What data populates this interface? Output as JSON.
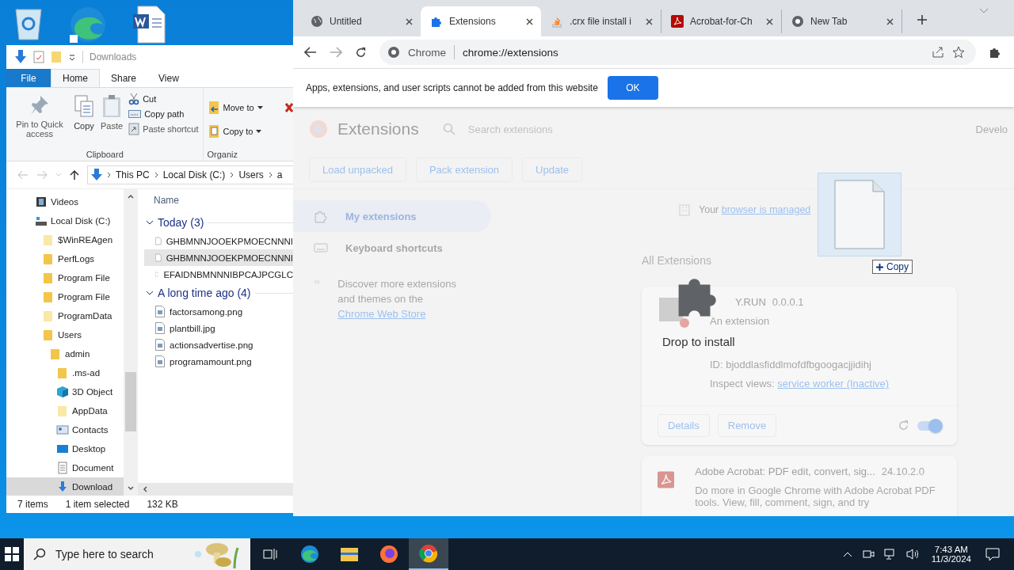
{
  "explorer": {
    "title": "Downloads",
    "ribbon_tabs": [
      {
        "label": "File",
        "kind": "file",
        "selected": false
      },
      {
        "label": "Home",
        "kind": "tab",
        "selected": true
      },
      {
        "label": "Share",
        "kind": "tab",
        "selected": false
      },
      {
        "label": "View",
        "kind": "tab",
        "selected": false
      }
    ],
    "clipboard": {
      "large": [
        {
          "label": "Pin to Quick access",
          "kind": "pin",
          "disabled": true
        },
        {
          "label": "Copy",
          "kind": "copy",
          "disabled": false
        },
        {
          "label": "Paste",
          "kind": "paste",
          "disabled": true
        }
      ],
      "small": [
        {
          "label": "Cut",
          "kind": "cut",
          "disabled": false
        },
        {
          "label": "Copy path",
          "kind": "path",
          "disabled": false
        },
        {
          "label": "Paste shortcut",
          "kind": "shortcut",
          "disabled": true
        }
      ],
      "group_label": "Clipboard"
    },
    "organize": {
      "items": [
        {
          "label": "Move to",
          "kind": "move"
        },
        {
          "label": "Copy to",
          "kind": "copyto"
        }
      ],
      "group_label": "Organiz"
    },
    "breadcrumb": [
      "This PC",
      "Local Disk (C:)",
      "Users",
      "a"
    ],
    "tree": [
      {
        "label": "Videos",
        "kind": "video",
        "selected": false
      },
      {
        "label": "Local Disk (C:)",
        "kind": "drive",
        "selected": false,
        "children": [
          {
            "label": "$WinREAgen",
            "kind": "folder-light",
            "selected": false
          },
          {
            "label": "PerfLogs",
            "kind": "folder",
            "selected": false
          },
          {
            "label": "Program File",
            "kind": "folder",
            "selected": false
          },
          {
            "label": "Program File",
            "kind": "folder",
            "selected": false
          },
          {
            "label": "ProgramData",
            "kind": "folder-light",
            "selected": false
          },
          {
            "label": "Users",
            "kind": "folder",
            "selected": false,
            "children": [
              {
                "label": "admin",
                "kind": "folder",
                "selected": false,
                "children": [
                  {
                    "label": ".ms-ad",
                    "kind": "folder",
                    "selected": false
                  },
                  {
                    "label": "3D Object",
                    "kind": "cube",
                    "selected": false
                  },
                  {
                    "label": "AppData",
                    "kind": "folder-light",
                    "selected": false
                  },
                  {
                    "label": "Contacts",
                    "kind": "contacts",
                    "selected": false
                  },
                  {
                    "label": "Desktop",
                    "kind": "desktop",
                    "selected": false
                  },
                  {
                    "label": "Document",
                    "kind": "documents",
                    "selected": false
                  },
                  {
                    "label": "Download",
                    "kind": "downloads",
                    "selected": true
                  }
                ]
              }
            ]
          }
        ]
      }
    ],
    "column_header": "Name",
    "groups": [
      {
        "label": "Today (3)",
        "expanded": true,
        "files": [
          {
            "name": "GHBMNNJOOEKPMOECNNNI",
            "kind": "blank",
            "selected": false
          },
          {
            "name": "GHBMNNJOOEKPMOECNNNI",
            "kind": "blank",
            "selected": true
          },
          {
            "name": "EFAIDNBMNNNIBPCAJPCGLC",
            "kind": "blank",
            "selected": false
          }
        ]
      },
      {
        "label": "A long time ago (4)",
        "expanded": true,
        "files": [
          {
            "name": "factorsamong.png",
            "kind": "image",
            "selected": false
          },
          {
            "name": "plantbill.jpg",
            "kind": "image",
            "selected": false
          },
          {
            "name": "actionsadvertise.png",
            "kind": "image",
            "selected": false
          },
          {
            "name": "programamount.png",
            "kind": "image",
            "selected": false
          }
        ]
      }
    ],
    "status": {
      "count": "7 items",
      "selection": "1 item selected",
      "size": "132 KB"
    }
  },
  "chrome": {
    "tabs": [
      {
        "title": "Untitled",
        "kind": "globe",
        "selected": false
      },
      {
        "title": "Extensions",
        "kind": "puzzle",
        "selected": true
      },
      {
        "title": ".crx file install i",
        "kind": "stack",
        "selected": false
      },
      {
        "title": "Acrobat-for-Ch",
        "kind": "pdf",
        "selected": false
      },
      {
        "title": "New Tab",
        "kind": "chrome",
        "selected": false
      }
    ],
    "address": {
      "site": "Chrome",
      "url": "chrome://extensions"
    },
    "infobar": {
      "message": "Apps, extensions, and user scripts cannot be added from this website",
      "button": "OK"
    },
    "page": {
      "title": "Extensions",
      "search": {
        "placeholder": "Search extensions"
      },
      "dev_mode_label": "Develo",
      "actions": [
        "Load unpacked",
        "Pack extension",
        "Update"
      ],
      "sidebar": [
        {
          "label": "My extensions",
          "kind": "extensions",
          "selected": true
        },
        {
          "label": "Keyboard shortcuts",
          "kind": "keyboard",
          "selected": false
        }
      ],
      "discover": {
        "text": "Discover more extensions and themes on the ",
        "link": "Chrome Web Store"
      },
      "managed": {
        "text": "Your",
        "link": "browser is managed"
      },
      "section_title": "All Extensions",
      "extensions": [
        {
          "name": "Y.RUN",
          "version": "0.0.0.1",
          "description": "An extension",
          "id": "ID: bjoddlasfiddlmofdfbgoogacjjidihj",
          "inspect": "Inspect views:",
          "inspect_link": "service worker (Inactive)",
          "buttons": [
            "Details",
            "Remove"
          ],
          "enabled": true,
          "kind": "anyrun"
        },
        {
          "name": "Adobe Acrobat: PDF edit, convert, sig...",
          "version": "24.10.2.0",
          "description": "Do more in Google Chrome with Adobe Acrobat PDF tools. View, fill, comment, sign, and try",
          "kind": "pdf"
        }
      ]
    },
    "drop": {
      "label": "Drop to install"
    },
    "drag": {
      "label": "Copy"
    }
  },
  "taskbar": {
    "search": {
      "placeholder": "Type here to search"
    },
    "apps": [
      {
        "kind": "taskview",
        "active": false
      },
      {
        "kind": "edge",
        "active": false
      },
      {
        "kind": "explorer",
        "active": false
      },
      {
        "kind": "firefox",
        "active": false
      },
      {
        "kind": "chrome",
        "active": true
      }
    ],
    "time": "7:43 AM",
    "date": "11/3/2024"
  }
}
